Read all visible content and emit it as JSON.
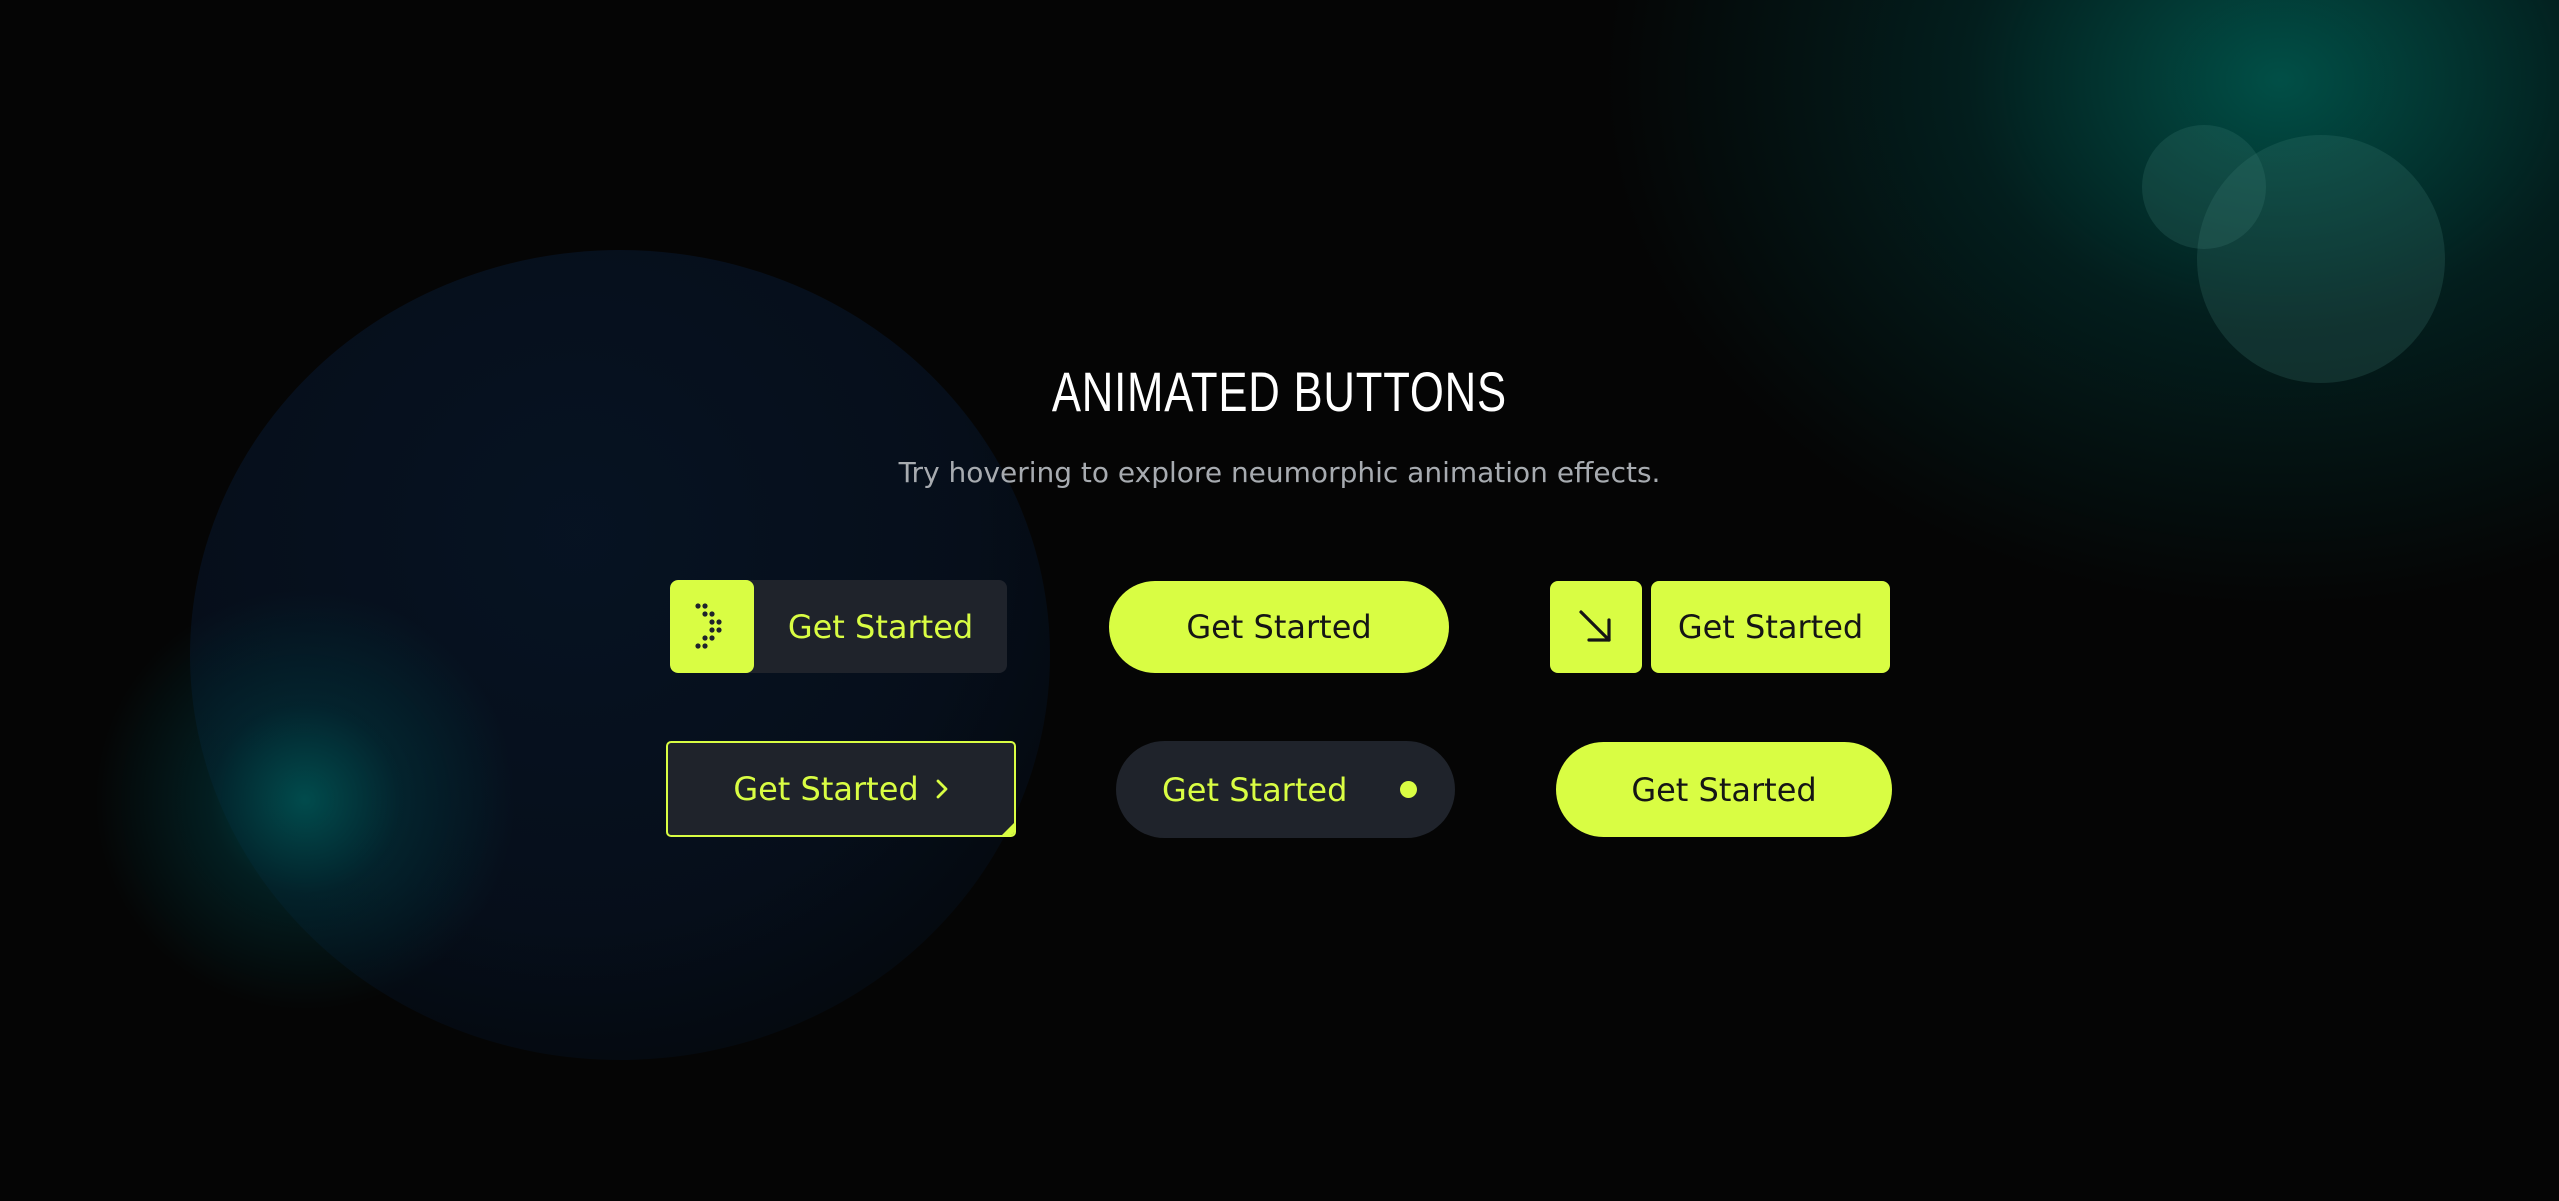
{
  "page": {
    "title": "ANIMATED BUTTONS",
    "subtitle": "Try hovering to explore neumorphic animation effects."
  },
  "buttons": [
    {
      "label": "Get Started",
      "icon": "dotted-arrow-icon"
    },
    {
      "label": "Get Started"
    },
    {
      "label": "Get Started",
      "icon": "arrow-down-right-icon"
    },
    {
      "label": "Get Started",
      "icon": "chevron-right-icon"
    },
    {
      "label": "Get Started",
      "icon": "dot-icon"
    },
    {
      "label": "Get Started"
    }
  ],
  "colors": {
    "accent": "#d9fd43",
    "dark_surface": "#1f232b",
    "background": "#050505",
    "title": "#ffffff",
    "subtitle": "#a7abb0"
  }
}
